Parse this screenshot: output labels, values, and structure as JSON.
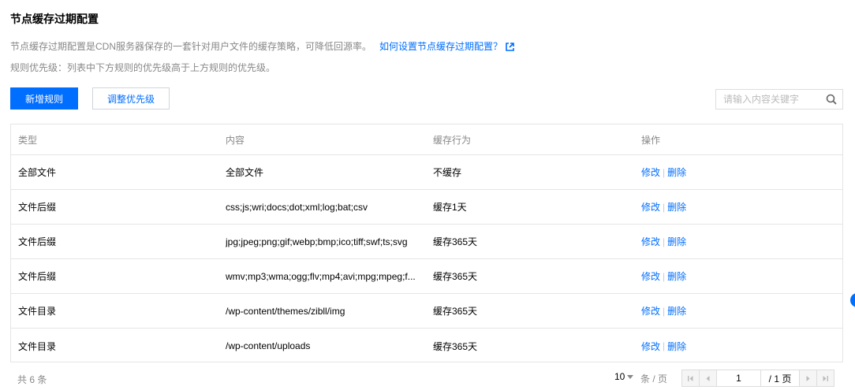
{
  "page": {
    "title": "节点缓存过期配置",
    "description": "节点缓存过期配置是CDN服务器保存的一套针对用户文件的缓存策略，可降低回源率。",
    "help_link": "如何设置节点缓存过期配置？",
    "priority_note": "规则优先级：列表中下方规则的优先级高于上方规则的优先级。"
  },
  "toolbar": {
    "add_rule_label": "新增规则",
    "adjust_priority_label": "调整优先级",
    "search_placeholder": "请输入内容关键字"
  },
  "table": {
    "headers": {
      "type": "类型",
      "content": "内容",
      "behavior": "缓存行为",
      "actions": "操作"
    },
    "rows": [
      {
        "type": "全部文件",
        "content": "全部文件",
        "behavior": "不缓存",
        "edit": "修改",
        "sep": "|",
        "delete": "删除"
      },
      {
        "type": "文件后缀",
        "content": "css;js;wri;docs;dot;xml;log;bat;csv",
        "behavior": "缓存1天",
        "edit": "修改",
        "sep": "|",
        "delete": "删除"
      },
      {
        "type": "文件后缀",
        "content": "jpg;jpeg;png;gif;webp;bmp;ico;tiff;swf;ts;svg",
        "behavior": "缓存365天",
        "edit": "修改",
        "sep": "|",
        "delete": "删除"
      },
      {
        "type": "文件后缀",
        "content": "wmv;mp3;wma;ogg;flv;mp4;avi;mpg;mpeg;f...",
        "behavior": "缓存365天",
        "edit": "修改",
        "sep": "|",
        "delete": "删除"
      },
      {
        "type": "文件目录",
        "content": "/wp-content/themes/zibll/img",
        "behavior": "缓存365天",
        "edit": "修改",
        "sep": "|",
        "delete": "删除"
      },
      {
        "type": "文件目录",
        "content": "/wp-content/uploads",
        "behavior": "缓存365天",
        "edit": "修改",
        "sep": "|",
        "delete": "删除"
      }
    ]
  },
  "pagination": {
    "total_text": "共 6 条",
    "page_size": "10",
    "page_size_unit": "条 / 页",
    "current_page": "1",
    "total_pages_text": "/ 1 页"
  },
  "icons": {
    "external_link": "external-link-icon",
    "search": "search-icon",
    "first_page": "first-page-icon",
    "prev_page": "prev-page-icon",
    "next_page": "next-page-icon",
    "last_page": "last-page-icon"
  },
  "colors": {
    "accent": "#006eff",
    "muted_text": "#888888",
    "border": "#e5e5e5"
  }
}
